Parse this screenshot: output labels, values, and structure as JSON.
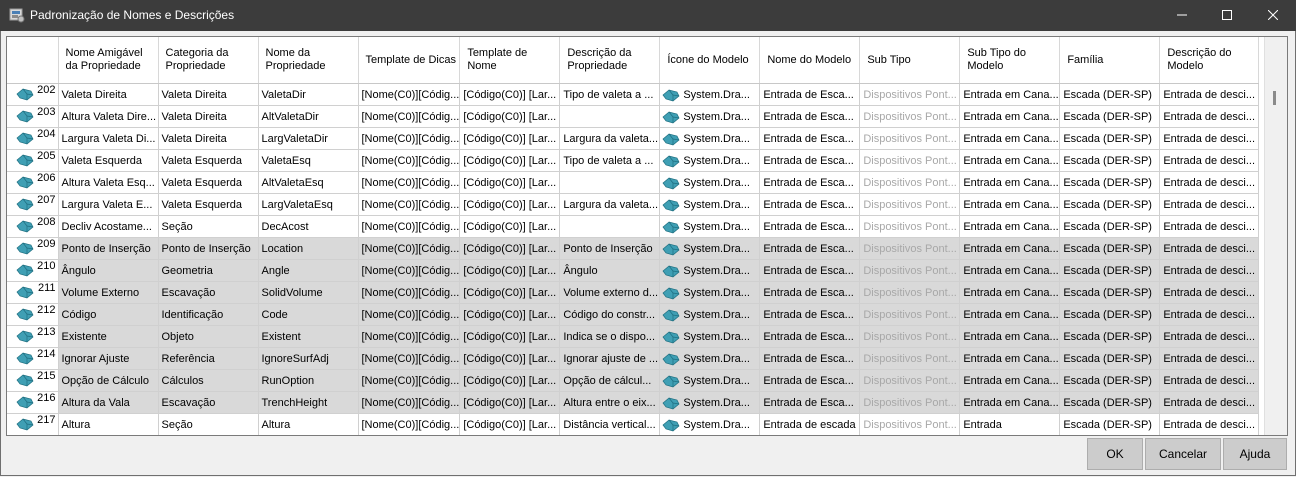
{
  "window": {
    "title": "Padronização de Nomes e Descrições"
  },
  "columns": [
    "Nome Amigável da Propriedade",
    "Categoria da Propriedade",
    "Nome da Propriedade",
    "Template de Dicas",
    "Template de Nome",
    "Descrição da Propriedade",
    "Ícone do Modelo",
    "Nome do Modelo",
    "Sub Tipo",
    "Sub Tipo do Modelo",
    "Família",
    "Descrição do Modelo"
  ],
  "rows": [
    {
      "id": "202",
      "nome": "Valeta Direita",
      "cat": "Valeta Direita",
      "prop": "ValetaDir",
      "dicas": "[Nome(C0)][Códig...",
      "tnome": "[Código(C0)] [Lar...",
      "desc": "Tipo de valeta a ...",
      "icone": "System.Dra...",
      "modelo": "Entrada de Esca...",
      "subtipo": "Dispositivos Pont...",
      "subm": "Entrada em Cana...",
      "fam": "Escada (DER-SP)",
      "descm": "Entrada de desci...",
      "sel": false
    },
    {
      "id": "203",
      "nome": "Altura Valeta Dire...",
      "cat": "Valeta Direita",
      "prop": "AltValetaDir",
      "dicas": "[Nome(C0)][Códig...",
      "tnome": "[Código(C0)] [Lar...",
      "desc": "",
      "icone": "System.Dra...",
      "modelo": "Entrada de Esca...",
      "subtipo": "Dispositivos Pont...",
      "subm": "Entrada em Cana...",
      "fam": "Escada (DER-SP)",
      "descm": "Entrada de desci...",
      "sel": false
    },
    {
      "id": "204",
      "nome": "Largura Valeta Di...",
      "cat": "Valeta Direita",
      "prop": "LargValetaDir",
      "dicas": "[Nome(C0)][Códig...",
      "tnome": "[Código(C0)] [Lar...",
      "desc": "Largura da valeta...",
      "icone": "System.Dra...",
      "modelo": "Entrada de Esca...",
      "subtipo": "Dispositivos Pont...",
      "subm": "Entrada em Cana...",
      "fam": "Escada (DER-SP)",
      "descm": "Entrada de desci...",
      "sel": false
    },
    {
      "id": "205",
      "nome": "Valeta Esquerda",
      "cat": "Valeta Esquerda",
      "prop": "ValetaEsq",
      "dicas": "[Nome(C0)][Códig...",
      "tnome": "[Código(C0)] [Lar...",
      "desc": "Tipo de valeta a ...",
      "icone": "System.Dra...",
      "modelo": "Entrada de Esca...",
      "subtipo": "Dispositivos Pont...",
      "subm": "Entrada em Cana...",
      "fam": "Escada (DER-SP)",
      "descm": "Entrada de desci...",
      "sel": false
    },
    {
      "id": "206",
      "nome": "Altura Valeta Esq...",
      "cat": "Valeta Esquerda",
      "prop": "AltValetaEsq",
      "dicas": "[Nome(C0)][Códig...",
      "tnome": "[Código(C0)] [Lar...",
      "desc": "",
      "icone": "System.Dra...",
      "modelo": "Entrada de Esca...",
      "subtipo": "Dispositivos Pont...",
      "subm": "Entrada em Cana...",
      "fam": "Escada (DER-SP)",
      "descm": "Entrada de desci...",
      "sel": false
    },
    {
      "id": "207",
      "nome": "Largura Valeta E...",
      "cat": "Valeta Esquerda",
      "prop": "LargValetaEsq",
      "dicas": "[Nome(C0)][Códig...",
      "tnome": "[Código(C0)] [Lar...",
      "desc": "Largura da valeta...",
      "icone": "System.Dra...",
      "modelo": "Entrada de Esca...",
      "subtipo": "Dispositivos Pont...",
      "subm": "Entrada em Cana...",
      "fam": "Escada (DER-SP)",
      "descm": "Entrada de desci...",
      "sel": false
    },
    {
      "id": "208",
      "nome": "Decliv Acostame...",
      "cat": "Seção",
      "prop": "DecAcost",
      "dicas": "[Nome(C0)][Códig...",
      "tnome": "[Código(C0)] [Lar...",
      "desc": "",
      "icone": "System.Dra...",
      "modelo": "Entrada de Esca...",
      "subtipo": "Dispositivos Pont...",
      "subm": "Entrada em Cana...",
      "fam": "Escada (DER-SP)",
      "descm": "Entrada de desci...",
      "sel": false
    },
    {
      "id": "209",
      "nome": "Ponto de Inserção",
      "cat": "Ponto de Inserção",
      "prop": "Location",
      "dicas": "[Nome(C0)][Códig...",
      "tnome": "[Código(C0)] [Lar...",
      "desc": "Ponto de Inserção",
      "icone": "System.Dra...",
      "modelo": "Entrada de Esca...",
      "subtipo": "Dispositivos Pont...",
      "subm": "Entrada em Cana...",
      "fam": "Escada (DER-SP)",
      "descm": "Entrada de desci...",
      "sel": true
    },
    {
      "id": "210",
      "nome": "Ângulo",
      "cat": "Geometria",
      "prop": "Angle",
      "dicas": "[Nome(C0)][Códig...",
      "tnome": "[Código(C0)] [Lar...",
      "desc": "Ângulo",
      "icone": "System.Dra...",
      "modelo": "Entrada de Esca...",
      "subtipo": "Dispositivos Pont...",
      "subm": "Entrada em Cana...",
      "fam": "Escada (DER-SP)",
      "descm": "Entrada de desci...",
      "sel": true
    },
    {
      "id": "211",
      "nome": "Volume Externo",
      "cat": "Escavação",
      "prop": "SolidVolume",
      "dicas": "[Nome(C0)][Códig...",
      "tnome": "[Código(C0)] [Lar...",
      "desc": "Volume externo d...",
      "icone": "System.Dra...",
      "modelo": "Entrada de Esca...",
      "subtipo": "Dispositivos Pont...",
      "subm": "Entrada em Cana...",
      "fam": "Escada (DER-SP)",
      "descm": "Entrada de desci...",
      "sel": true
    },
    {
      "id": "212",
      "nome": "Código",
      "cat": "Identificação",
      "prop": "Code",
      "dicas": "[Nome(C0)][Códig...",
      "tnome": "[Código(C0)] [Lar...",
      "desc": "Código do constr...",
      "icone": "System.Dra...",
      "modelo": "Entrada de Esca...",
      "subtipo": "Dispositivos Pont...",
      "subm": "Entrada em Cana...",
      "fam": "Escada (DER-SP)",
      "descm": "Entrada de desci...",
      "sel": true
    },
    {
      "id": "213",
      "nome": "Existente",
      "cat": "Objeto",
      "prop": "Existent",
      "dicas": "[Nome(C0)][Códig...",
      "tnome": "[Código(C0)] [Lar...",
      "desc": "Indica se o dispo...",
      "icone": "System.Dra...",
      "modelo": "Entrada de Esca...",
      "subtipo": "Dispositivos Pont...",
      "subm": "Entrada em Cana...",
      "fam": "Escada (DER-SP)",
      "descm": "Entrada de desci...",
      "sel": true
    },
    {
      "id": "214",
      "nome": "Ignorar Ajuste",
      "cat": "Referência",
      "prop": "IgnoreSurfAdj",
      "dicas": "[Nome(C0)][Códig...",
      "tnome": "[Código(C0)] [Lar...",
      "desc": "Ignorar ajuste de ...",
      "icone": "System.Dra...",
      "modelo": "Entrada de Esca...",
      "subtipo": "Dispositivos Pont...",
      "subm": "Entrada em Cana...",
      "fam": "Escada (DER-SP)",
      "descm": "Entrada de desci...",
      "sel": true
    },
    {
      "id": "215",
      "nome": "Opção de Cálculo",
      "cat": "Cálculos",
      "prop": "RunOption",
      "dicas": "[Nome(C0)][Códig...",
      "tnome": "[Código(C0)] [Lar...",
      "desc": "Opção de cálcul...",
      "icone": "System.Dra...",
      "modelo": "Entrada de Esca...",
      "subtipo": "Dispositivos Pont...",
      "subm": "Entrada em Cana...",
      "fam": "Escada (DER-SP)",
      "descm": "Entrada de desci...",
      "sel": true
    },
    {
      "id": "216",
      "nome": "Altura da Vala",
      "cat": "Escavação",
      "prop": "TrenchHeight",
      "dicas": "[Nome(C0)][Códig...",
      "tnome": "[Código(C0)] [Lar...",
      "desc": "Altura entre o eix...",
      "icone": "System.Dra...",
      "modelo": "Entrada de Esca...",
      "subtipo": "Dispositivos Pont...",
      "subm": "Entrada em Cana...",
      "fam": "Escada (DER-SP)",
      "descm": "Entrada de desci...",
      "sel": true
    },
    {
      "id": "217",
      "nome": "Altura",
      "cat": "Seção",
      "prop": "Altura",
      "dicas": "[Nome(C0)][Códig...",
      "tnome": "[Código(C0)] [Lar...",
      "desc": "Distância vertical...",
      "icone": "System.Dra...",
      "modelo": "Entrada de escada",
      "subtipo": "Dispositivos Pont...",
      "subm": "Entrada",
      "fam": "Escada (DER-SP)",
      "descm": "Entrada de desci...",
      "sel": false
    }
  ],
  "buttons": {
    "ok": "OK",
    "cancel": "Cancelar",
    "help": "Ajuda"
  }
}
